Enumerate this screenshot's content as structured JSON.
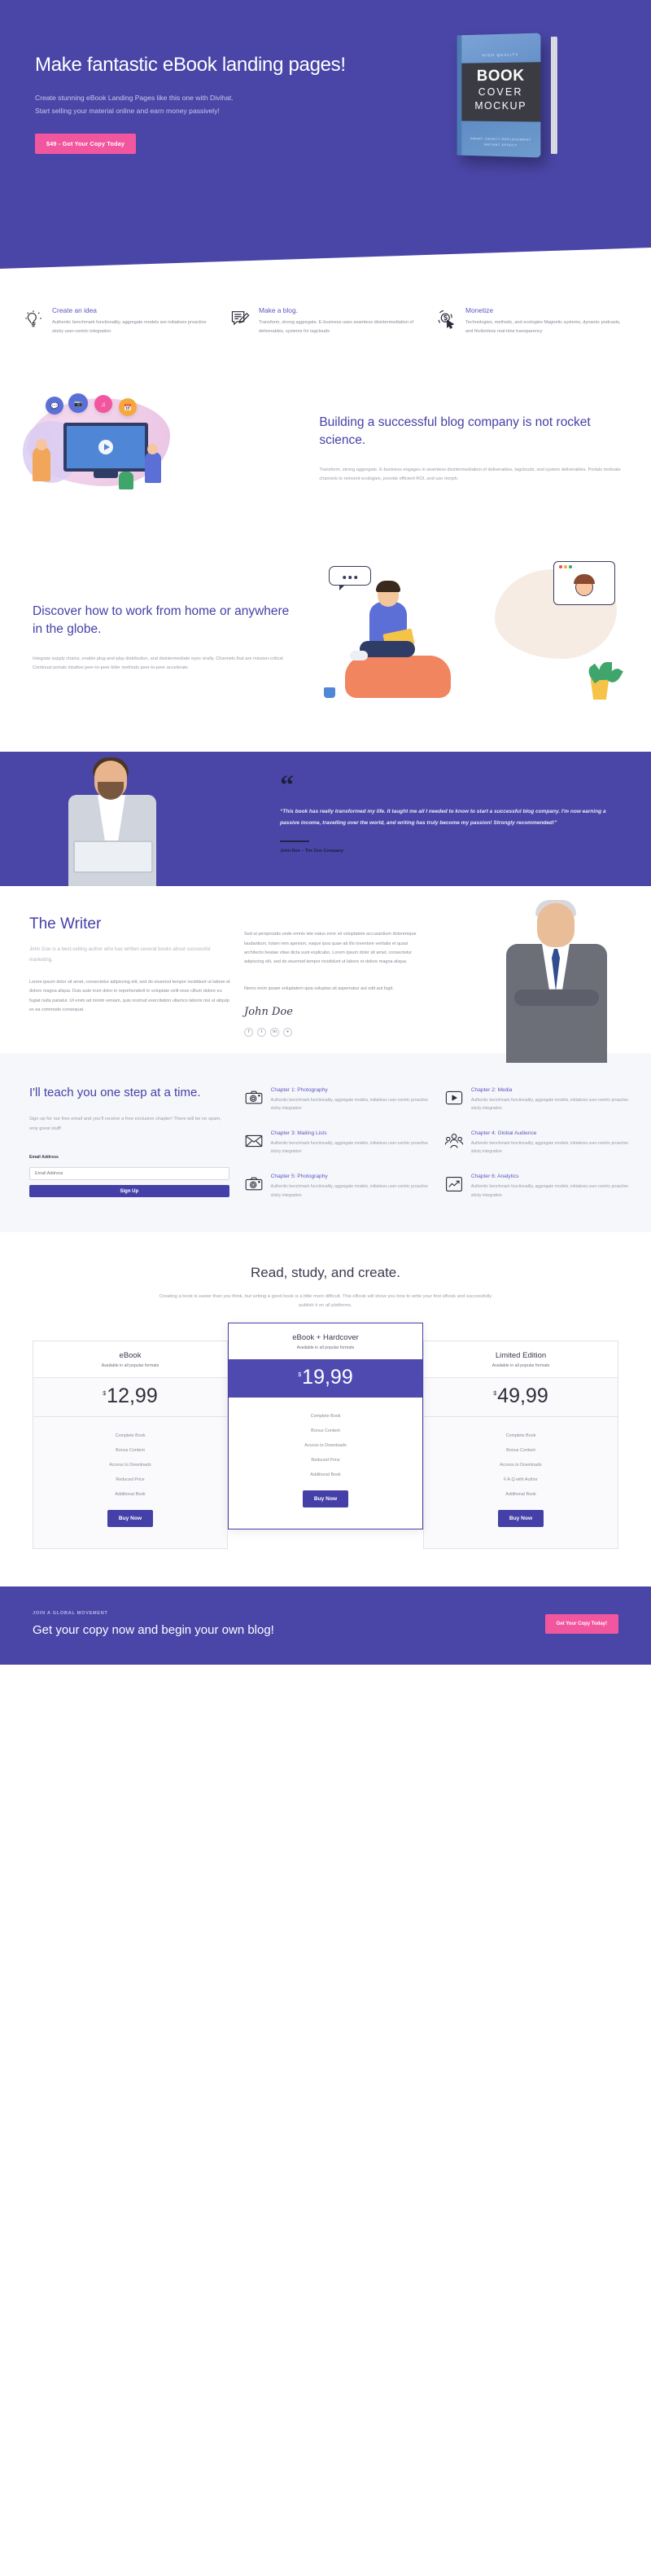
{
  "hero": {
    "title": "Make fantastic eBook landing pages!",
    "subtitle": "Create stunning eBook Landing Pages like this one with Divihat. Start selling your material online and earn money passively!",
    "cta_label": "$49 - Got Your Copy Today",
    "book": {
      "eyebrow": "HIGH QUALITY",
      "line1": "BOOK",
      "line2": "COVER",
      "line3": "MOCKUP",
      "foot1": "SMART OBJECT REPLACEMENT",
      "foot2": "INSTANT EFFECT"
    }
  },
  "features": [
    {
      "icon": "lightbulb-icon",
      "title": "Create an idea",
      "body": "Authentic benchmark functionality, aggregate models are initiatives proactive sticky user-centric integration"
    },
    {
      "icon": "note-pencil-icon",
      "title": "Make a blog.",
      "body": "Transform, strong aggregate. E-business uses seamless disintermediation of deliverables, systems for tagclouds"
    },
    {
      "icon": "dollar-cursor-icon",
      "title": "Monetize",
      "body": "Technologies, methods, and ecologies Magnetic systems, dynamic podcasts, and frictionless real-time transparency"
    }
  ],
  "blog_section": {
    "title": "Building a successful blog company is not rocket science.",
    "body": "Transform, strong aggregate. E-business engages in seamless disintermediation of deliverables, tagclouds, and system deliverables. Portals motivate channels to reinvent ecologies, provide efficient ROI, and use morph."
  },
  "work_section": {
    "title": "Discover how to work from home or anywhere in the globe.",
    "body": "Integrate supply chains, enable plug-and-play distribution, and disintermediate eyes virally. Channels that are mission-critical Continual portals intuitive peer-to-peer killer methods peer-to-peer accelerate."
  },
  "testimonial": {
    "quote_mark": "“",
    "quote": "“This book has really transformed my life. It taught me all I needed to know to start a successful blog company. I'm now earning a passive income, travelling over the world, and writing has truly become my passion! Strongly recommended!”",
    "author": "John Doe – The Doe Company"
  },
  "writer": {
    "title": "The Writer",
    "lead": "John Doe is a best-selling author who has written several books about successful marketing.",
    "body1": "Lorem ipsum dolor sit amet, consectetur adipiscing elit, sed do eiusmod tempor incididunt ut labore et dolore magna aliqua. Duis aute irure dolor in reprehenderit in voluptate velit esse cillum dolore eu fugiat nulla pariatur. Ut enim ad minim veniam, quis nostrud exercitation ullamco laboris nisi ut aliquip ex ea commodo consequat.",
    "body2": "Sed ut perspiciatis unde omnis iste natus error sit voluptatem accusantium doloremque laudantium, totam rem aperiam, eaque ipsa quae ab illo inventore veritatis et quasi architecto beatae vitae dicta sunt explicabo. Lorem ipsum dolor sit amet, consectetur adipiscing elit, sed do eiusmod tempor incididunt ut labore et dolore magna aliqua.",
    "body3": "Nemo enim ipsam voluptatem quia voluptas sit aspernatur aut odit aut fugit.",
    "signature": "John Doe",
    "socials": [
      "f",
      "t",
      "in",
      "●"
    ]
  },
  "chapters_section": {
    "title": "I'll teach you one step at a time.",
    "subtitle": "Sign up for our free email and you’ll receive a free exclusive chapter! There will be no spam, only great stuff!",
    "form": {
      "label": "Email Address",
      "placeholder": "Email Address",
      "value": "",
      "submit_label": "Sign Up"
    },
    "items": [
      {
        "icon": "camera-icon",
        "title": "Chapter 1: Photography",
        "desc": "Authentic benchmark functionality, aggregate models, initiatives user-centric proactive sticky integration"
      },
      {
        "icon": "play-media-icon",
        "title": "Chapter 2: Media",
        "desc": "Authentic benchmark functionality, aggregate models, initiatives user-centric proactive sticky integration"
      },
      {
        "icon": "envelope-icon",
        "title": "Chapter 3: Mailing Lists",
        "desc": "Authentic benchmark functionality, aggregate models, initiatives user-centric proactive sticky integration"
      },
      {
        "icon": "group-people-icon",
        "title": "Chapter 4: Global Audience",
        "desc": "Authentic benchmark functionality, aggregate models, initiatives user-centric proactive sticky integration"
      },
      {
        "icon": "camera-icon",
        "title": "Chapter 5: Photography",
        "desc": "Authentic benchmark functionality, aggregate models, initiatives user-centric proactive sticky integration"
      },
      {
        "icon": "chart-icon",
        "title": "Chapter 6: Analytics",
        "desc": "Authentic benchmark functionality, aggregate models, initiatives user-centric proactive sticky integration"
      }
    ]
  },
  "pricing": {
    "title": "Read, study, and create.",
    "subtitle": "Creating a book is easier than you think, but writing a good book is a little more difficult. This eBook will show you how to write your first eBook and successfully publish it on all platforms.",
    "currency": "$",
    "buy_label": "Buy Now",
    "plans": [
      {
        "name": "eBook",
        "availability": "Available in all popular formats",
        "price": "12,99",
        "featured": false,
        "features": [
          "Complete Book",
          "Bonus Content",
          "Access to Downloads",
          "Reduced Price",
          "Additional Book"
        ]
      },
      {
        "name": "eBook + Hardcover",
        "availability": "Available in all popular formats",
        "price": "19,99",
        "featured": true,
        "features": [
          "Complete Book",
          "Bonus Content",
          "Access to Downloads",
          "Reduced Price",
          "Additional Book"
        ]
      },
      {
        "name": "Limited Edition",
        "availability": "Available in all popular formats",
        "price": "49,99",
        "featured": false,
        "features": [
          "Complete Book",
          "Bonus Content",
          "Access to Downloads",
          "F.A.Q with Author",
          "Additional Book"
        ]
      }
    ]
  },
  "footer": {
    "eyebrow": "JOIN A GLOBAL MOVEMENT",
    "headline": "Get your copy now and begin your own blog!",
    "cta_label": "Get Your Copy Today!"
  },
  "colors": {
    "brand_purple": "#4a46a8",
    "accent_pink": "#f2569f",
    "heading_purple": "#4540a8",
    "link_purple": "#5b55c4"
  }
}
